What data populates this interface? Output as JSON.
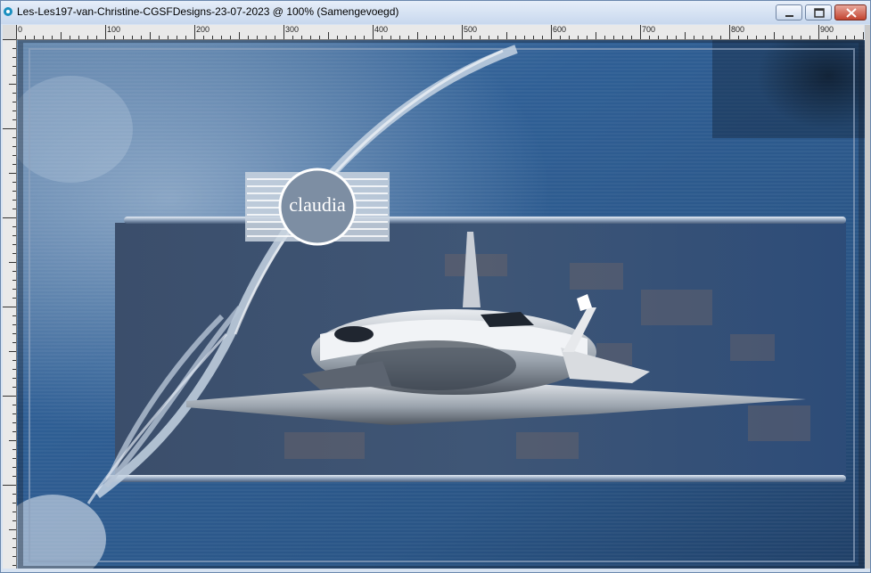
{
  "window": {
    "title": "Les-Les197-van-Christine-CGSFDesigns-23-07-2023 @ 100% (Samengevoegd)"
  },
  "controls": {
    "minimize_icon": "minimize-icon",
    "maximize_icon": "maximize-icon",
    "close_icon": "close-icon"
  },
  "ruler": {
    "labels": [
      "0",
      "100",
      "200",
      "300",
      "400",
      "500",
      "600",
      "700",
      "800",
      "900"
    ]
  },
  "artwork": {
    "watermark_text": "claudia",
    "colors": {
      "background": "#2f5a8a",
      "frame": "#8fa3bd",
      "dark": "#1a2638"
    }
  }
}
